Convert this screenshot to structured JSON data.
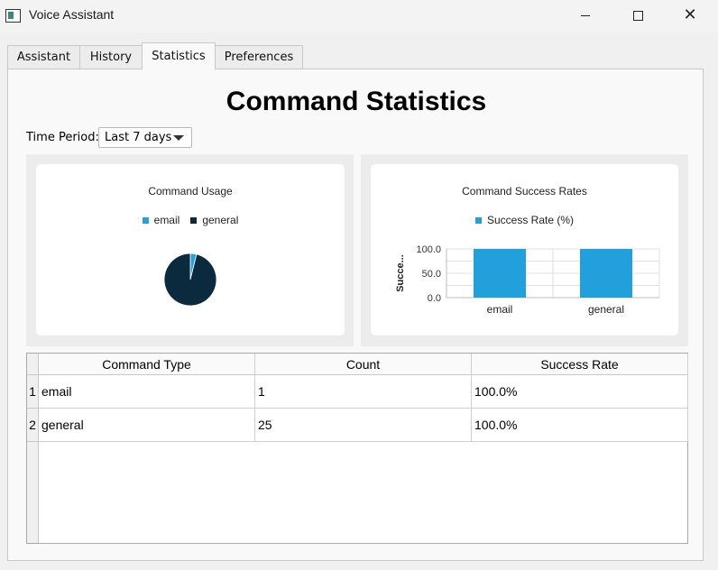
{
  "window": {
    "title": "Voice Assistant"
  },
  "tabs": [
    {
      "label": "Assistant",
      "active": false
    },
    {
      "label": "History",
      "active": false
    },
    {
      "label": "Statistics",
      "active": true
    },
    {
      "label": "Preferences",
      "active": false
    }
  ],
  "page": {
    "heading": "Command Statistics",
    "time_period_label": "Time Period:",
    "time_period_value": "Last 7 days"
  },
  "colors": {
    "email": "#2aa0d8",
    "general": "#0b2a3e",
    "bar": "#22a0dc"
  },
  "chart_data": [
    {
      "type": "pie",
      "title": "Command Usage",
      "legend_position": "top",
      "categories": [
        "email",
        "general"
      ],
      "values": [
        1,
        25
      ]
    },
    {
      "type": "bar",
      "title": "Command Success Rates",
      "legend_position": "top",
      "categories": [
        "email",
        "general"
      ],
      "series": [
        {
          "name": "Success Rate (%)",
          "values": [
            100.0,
            100.0
          ]
        }
      ],
      "ylabel": "Succe...",
      "ylim": [
        0,
        100
      ],
      "yticks": [
        "100.0",
        "50.0",
        "0.0"
      ],
      "grid": true
    }
  ],
  "table": {
    "headers": [
      "Command Type",
      "Count",
      "Success Rate"
    ],
    "rows": [
      {
        "index": "1",
        "type": "email",
        "count": "1",
        "rate": "100.0%"
      },
      {
        "index": "2",
        "type": "general",
        "count": "25",
        "rate": "100.0%"
      }
    ]
  }
}
